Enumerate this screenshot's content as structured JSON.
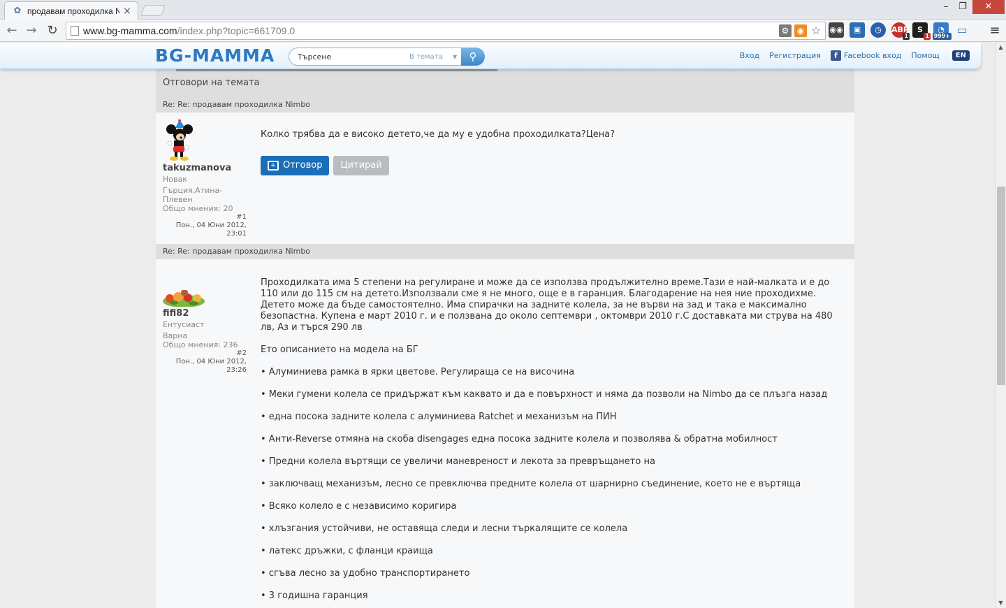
{
  "browser": {
    "tab_title": "продавам проходилка Ni",
    "url_host": "www.bg-mamma.com",
    "url_path": "/index.php?topic=661709.0",
    "window_min": "–",
    "window_max": "❐",
    "window_close": "✕",
    "extension_badges": {
      "abp": "1",
      "s_ext": "1",
      "rss_count": "999+"
    }
  },
  "site": {
    "logo": "BG-MAMMA",
    "search_placeholder": "Търсене",
    "search_scope": "В темата",
    "links": {
      "login": "Вход",
      "register": "Регистрация",
      "facebook": "Facebook вход",
      "help": "Помощ",
      "lang": "EN"
    }
  },
  "forum": {
    "section_title": "Отговори на темата",
    "posts": [
      {
        "subject": "Re: Re: продавам проходилка Nimbo",
        "username": "takuzmanova",
        "rank": "Новак",
        "location": "Гърция,Атина-Плевен",
        "posts_count": "Общо мнения: 20",
        "num": "#1",
        "date_line1": "Пон., 04 Юни 2012,",
        "date_line2": "23:01",
        "text": "Колко трябва да е високо детето,че да му е удобна проходилката?Цена?",
        "reply_label": "Отговор",
        "quote_label": "Цитирай"
      },
      {
        "subject": "Re: Re: продавам проходилка Nimbo",
        "username": "fifi82",
        "rank": "Ентусиаст",
        "location": "Варна",
        "posts_count": "Общо мнения: 236",
        "num": "#2",
        "date_line1": "Пон., 04 Юни 2012,",
        "date_line2": "23:26",
        "paragraphs": [
          "Проходилката има 5 степени на регулиране и може да се използва продължително време.Тази е най-малката и е до 110 или до 115 см на детето.Използвали сме я не много, още е в гаранция. Благодарение на нея ние проходихме. Детето може да бъде самостоятелно. Има спирачки на задните колела, за не върви на зад и така е максимално безопастна. Купена е март 2010 г. и е ползвана до около септември , октомври 2010 г.С доставката ми струва на 480 лв, Аз и търся 290 лв",
          "Ето описанието на модела на БГ",
          "• Алуминиева рамка в ярки цветове. Регулираща се на височина",
          "• Меки гумени колела се придържат към каквато и да е повърхност и няма да позволи на Nimbo да се плъзга назад",
          "• една посока задните колела с алуминиева Ratchet и механизъм на ПИН",
          "• Анти-Reverse отмяна на скоба disengages една посока задните колела и позволява & обратна мобилност",
          "• Предни колела въртящи се увеличи маневреност и лекота за превръщането на",
          "• заключващ механизъм, лесно се превключва предните колела от шарнирно съединение, което не е въртяща",
          "• Всяко колело е с независимо коригира",
          "• хлъзгания устойчиви, не оставяща следи и лесни търкалящите се колела",
          "• латекс дръжки, с фланци краища",
          "• сгъва лесно за удобно транспортирането",
          "• 3 годишна гаранция"
        ]
      }
    ]
  },
  "icons": {
    "favicon": "favicon-icon",
    "back": "back-arrow-icon",
    "forward": "forward-arrow-icon",
    "reload": "reload-icon",
    "star": "star-icon",
    "rss": "rss-icon",
    "search": "search-icon",
    "menu": "menu-icon"
  },
  "colors": {
    "brand_blue": "#2b7ac2",
    "reply_button": "#1b6eb8",
    "quote_button": "#b9bcc0",
    "section_bg": "#dedede"
  }
}
